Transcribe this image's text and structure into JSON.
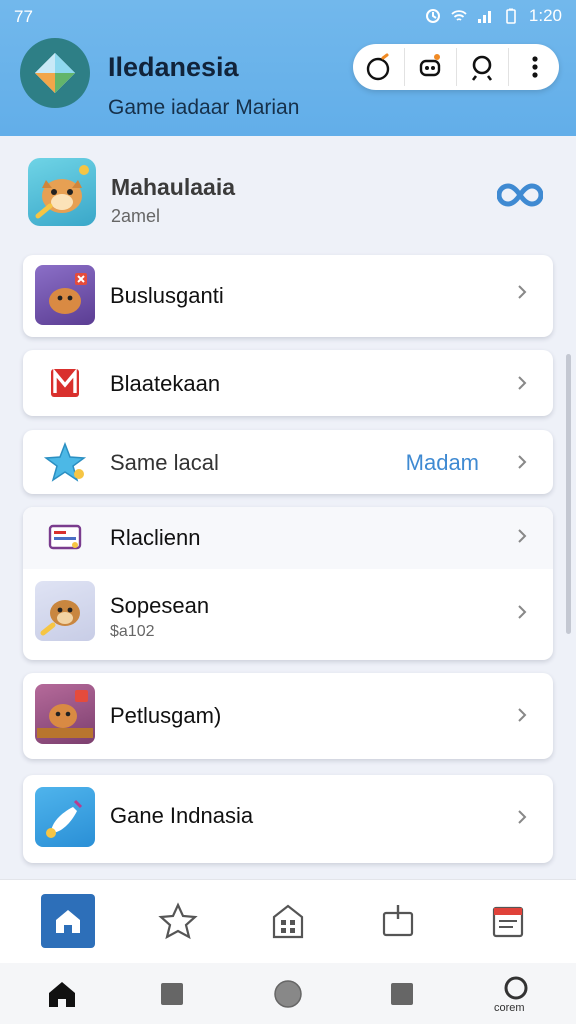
{
  "status_bar": {
    "left_text": "77",
    "time": "1:20"
  },
  "app": {
    "title": "Iledanesia",
    "subtitle": "Game iadaar Marian",
    "action_icons": [
      "timer-icon",
      "robot-icon",
      "search-icon",
      "more-vertical-icon"
    ]
  },
  "profile": {
    "name": "Mahaulaaia",
    "subtitle": "2amel",
    "link_icon": "infinity-link-icon"
  },
  "cards": [
    {
      "label": "Buslusganti",
      "icon": "hamster-sword-icon"
    },
    {
      "label": "Blaatekaan",
      "icon": "m-logo-icon"
    },
    {
      "label": "Same lacal",
      "value": "Madam",
      "icon": "star-fish-icon"
    },
    {
      "label": "Rlaclienn",
      "icon": "keyboard-icon"
    },
    {
      "label": "Sopesean",
      "subtitle": "$a102",
      "icon": "squirrel-icon"
    },
    {
      "label": "Petlusgam)",
      "icon": "hamster-box-icon"
    },
    {
      "label": "Gane Indnasia",
      "icon": "paint-brush-icon"
    }
  ],
  "bottom_nav": [
    {
      "name": "home",
      "icon": "home-icon",
      "active": true
    },
    {
      "name": "favorites",
      "icon": "star-icon"
    },
    {
      "name": "store",
      "icon": "building-icon"
    },
    {
      "name": "inbox",
      "icon": "tray-icon"
    },
    {
      "name": "calendar",
      "icon": "calendar-icon"
    }
  ],
  "system_nav": {
    "label": "corem"
  },
  "colors": {
    "header": "#66b0ea",
    "accent": "#3f8ad2",
    "active_tab": "#2d6fb9"
  }
}
